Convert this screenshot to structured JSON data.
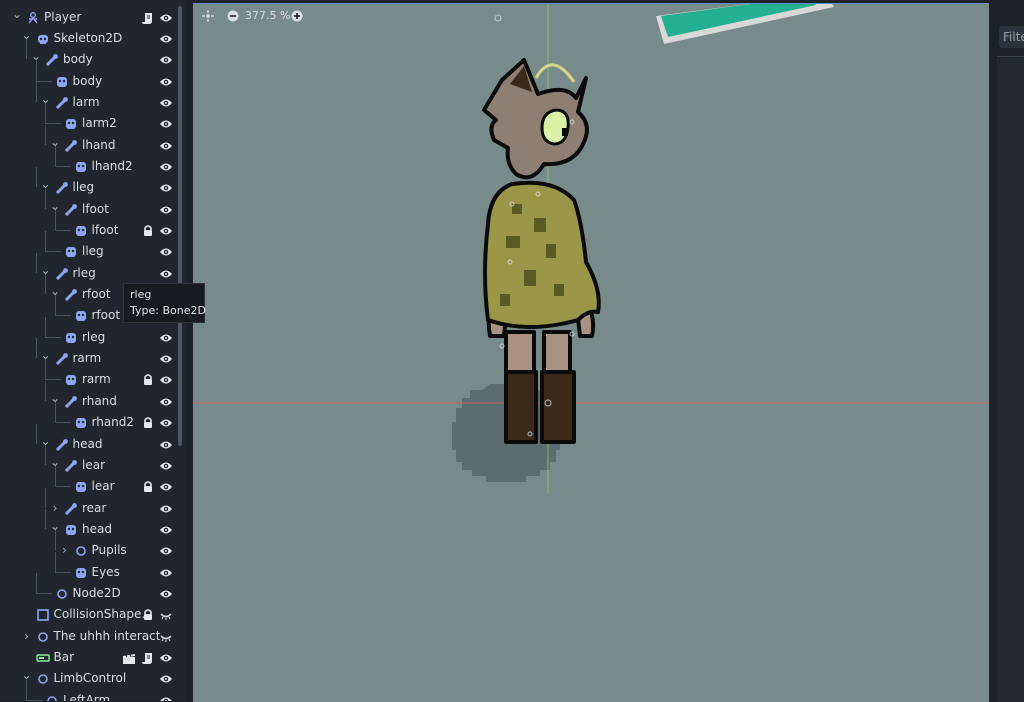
{
  "scene_tree": {
    "rows": [
      {
        "label": "Player",
        "icon": "character-body-icon",
        "expander": "open",
        "script": true,
        "vis": "eye"
      },
      {
        "label": "Skeleton2D",
        "icon": "skeleton-icon",
        "expander": "open",
        "vis": "eye"
      },
      {
        "label": "body",
        "icon": "bone-icon",
        "expander": "open",
        "vis": "eye"
      },
      {
        "label": "body",
        "icon": "polygon-icon",
        "vis": "eye"
      },
      {
        "label": "larm",
        "icon": "bone-icon",
        "expander": "open",
        "vis": "eye"
      },
      {
        "label": "larm2",
        "icon": "polygon-icon",
        "vis": "eye"
      },
      {
        "label": "lhand",
        "icon": "bone-icon",
        "expander": "open",
        "vis": "eye"
      },
      {
        "label": "lhand2",
        "icon": "polygon-icon",
        "vis": "eye"
      },
      {
        "label": "lleg",
        "icon": "bone-icon",
        "expander": "open",
        "vis": "eye"
      },
      {
        "label": "lfoot",
        "icon": "bone-icon",
        "expander": "open",
        "vis": "eye"
      },
      {
        "label": "lfoot",
        "icon": "polygon-icon",
        "lock": true,
        "vis": "eye"
      },
      {
        "label": "lleg",
        "icon": "polygon-icon",
        "vis": "eye"
      },
      {
        "label": "rleg",
        "icon": "bone-icon",
        "expander": "open",
        "vis": "eye"
      },
      {
        "label": "rfoot",
        "icon": "bone-icon",
        "expander": "open",
        "vis": "eye"
      },
      {
        "label": "rfoot",
        "icon": "polygon-icon",
        "vis": "eye"
      },
      {
        "label": "rleg",
        "icon": "polygon-icon",
        "vis": "eye"
      },
      {
        "label": "rarm",
        "icon": "bone-icon",
        "expander": "open",
        "vis": "eye"
      },
      {
        "label": "rarm",
        "icon": "polygon-icon",
        "lock": true,
        "vis": "eye"
      },
      {
        "label": "rhand",
        "icon": "bone-icon",
        "expander": "open",
        "vis": "eye"
      },
      {
        "label": "rhand2",
        "icon": "polygon-icon",
        "lock": true,
        "vis": "eye"
      },
      {
        "label": "head",
        "icon": "bone-icon",
        "expander": "open",
        "vis": "eye"
      },
      {
        "label": "lear",
        "icon": "bone-icon",
        "expander": "open",
        "vis": "eye"
      },
      {
        "label": "lear",
        "icon": "polygon-icon",
        "lock": true,
        "vis": "eye"
      },
      {
        "label": "rear",
        "icon": "bone-icon",
        "expander": "closed",
        "vis": "eye"
      },
      {
        "label": "head",
        "icon": "polygon-icon",
        "expander": "open",
        "vis": "eye"
      },
      {
        "label": "Pupils",
        "icon": "node2d-icon",
        "expander": "closed",
        "vis": "eye"
      },
      {
        "label": "Eyes",
        "icon": "polygon-icon",
        "vis": "eye"
      },
      {
        "label": "Node2D",
        "icon": "node2d-icon",
        "vis": "eye"
      },
      {
        "label": "CollisionShape…",
        "icon": "collision-shape-icon",
        "lock": true,
        "vis": "closed-eye"
      },
      {
        "label": "The uhhh interact",
        "icon": "node2d-icon",
        "expander": "closed",
        "vis": "closed-eye"
      },
      {
        "label": "Bar",
        "icon": "progress-bar-icon",
        "clapper": true,
        "script": true,
        "vis": "eye"
      },
      {
        "label": "LimbControl",
        "icon": "node2d-icon",
        "expander": "open",
        "vis": "eye"
      },
      {
        "label": "LeftArm",
        "icon": "node2d-icon",
        "vis": "eye"
      }
    ]
  },
  "tooltip": {
    "title": "rleg",
    "type_text": "Type: Bone2D"
  },
  "toolbar": {
    "zoom_label": "377.5 %"
  },
  "right_panel": {
    "filter_label": "Filte"
  },
  "colors": {
    "bone": "#8da5f3",
    "polygon": "#8da5f3",
    "node": "#8da5f3",
    "control": "#8eef97",
    "viewport": "#778b8b",
    "teal_shape": "#23b091",
    "origin_x_axis": "#e05a5a",
    "origin_y_axis": "#9ad35a"
  }
}
